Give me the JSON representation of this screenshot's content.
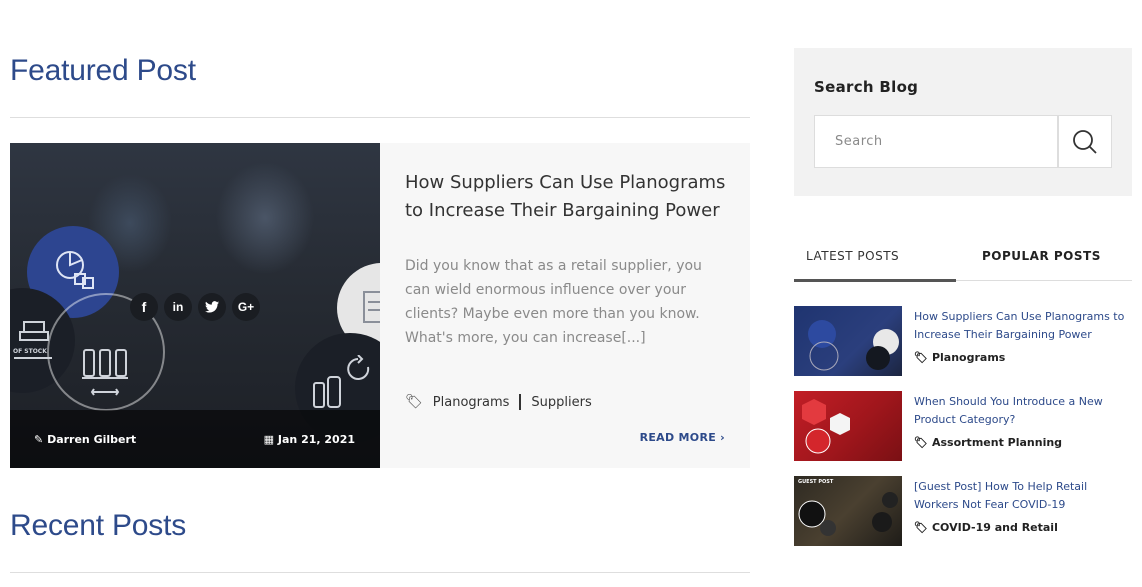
{
  "featured": {
    "section_title": "Featured Post",
    "post": {
      "title": "How Suppliers Can Use Planograms to Increase Their Bargaining Power",
      "excerpt": "Did you know that as a retail supplier, you can wield enormous influence over your clients? Maybe even more than you know. What's more, you can increase[...]",
      "author": "Darren Gilbert",
      "date": "Jan 21, 2021",
      "tags": [
        "Planograms",
        "Suppliers"
      ],
      "read_more": "READ MORE ›",
      "social": [
        "f",
        "in",
        "t",
        "G+"
      ],
      "image_badge": "OF STOCK"
    }
  },
  "recent": {
    "section_title": "Recent Posts"
  },
  "sidebar": {
    "search": {
      "title": "Search Blog",
      "placeholder": "Search"
    },
    "tabs": [
      {
        "label": "LATEST POSTS",
        "active": true
      },
      {
        "label": "POPULAR POSTS",
        "active": false
      }
    ],
    "posts": [
      {
        "title": "How Suppliers Can Use Planograms to Increase Their Bargaining Power",
        "category": "Planograms",
        "thumb_label": ""
      },
      {
        "title": "When Should You Introduce a New Product Category?",
        "category": "Assortment Planning",
        "thumb_label": ""
      },
      {
        "title": "[Guest Post] How To Help Retail Workers Not Fear COVID-19",
        "category": "COVID-19 and Retail",
        "thumb_label": "GUEST POST"
      }
    ]
  },
  "colors": {
    "accent": "#2d4a8a",
    "social_bg": "#1a1d22",
    "card_bg": "#f7f7f7"
  }
}
